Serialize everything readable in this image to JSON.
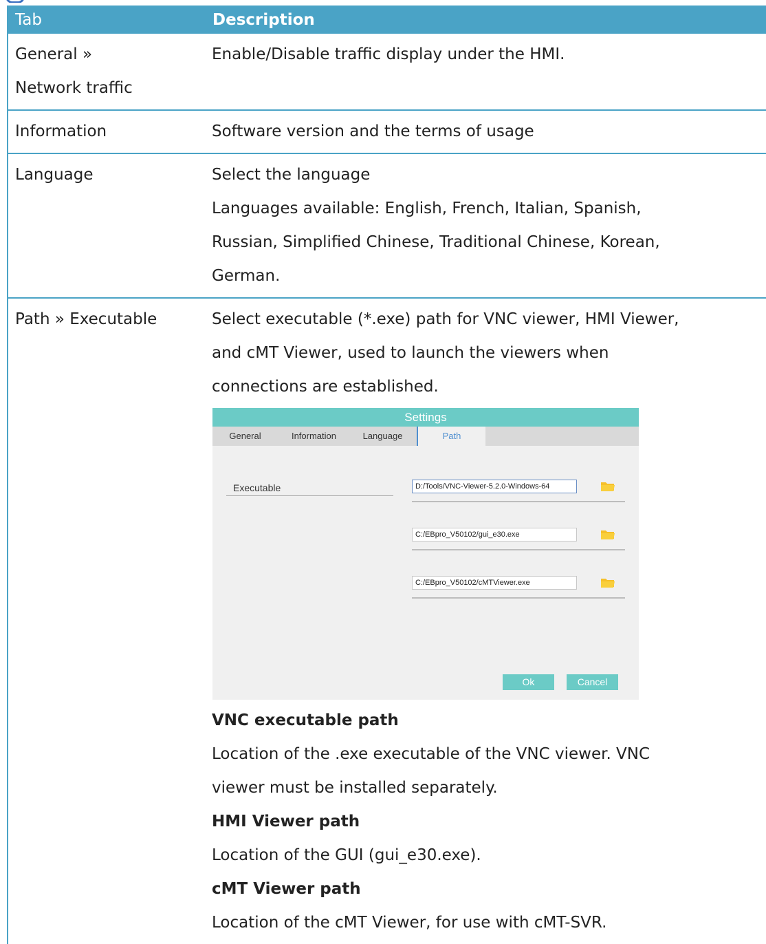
{
  "table": {
    "headers": {
      "tab": "Tab",
      "description": "Description"
    },
    "rows": {
      "general": {
        "tab_line1": "General »",
        "tab_line2": "Network traffic",
        "description": "Enable/Disable traffic display under the HMI."
      },
      "information": {
        "tab": "Information",
        "description": "Software version and the terms of usage"
      },
      "language": {
        "tab": "Language",
        "line1": "Select the language",
        "line2": "Languages available: English, French, Italian, Spanish,",
        "line3": "Russian, Simplified Chinese, Traditional Chinese, Korean,",
        "line4": "German."
      },
      "path": {
        "tab": "Path » Executable",
        "intro1": "Select executable (*.exe) path for VNC viewer, HMI Viewer,",
        "intro2": "and cMT Viewer, used to launch the viewers when",
        "intro3": "connections are established.",
        "vnc_heading": "VNC executable path",
        "vnc_text1": "Location of the .exe executable of the VNC viewer. VNC",
        "vnc_text2": "viewer must be installed separately.",
        "hmi_heading": "HMI Viewer path",
        "hmi_text": "Location of the GUI (gui_e30.exe).",
        "cmt_heading": "cMT Viewer path",
        "cmt_text": "Location of the cMT Viewer, for use with cMT-SVR."
      }
    }
  },
  "dialog": {
    "title": "Settings",
    "tabs": {
      "general": "General",
      "information": "Information",
      "language": "Language",
      "path": "Path"
    },
    "active_tab": "Path",
    "section_label": "Executable",
    "vnc": {
      "label": "VNC executable path",
      "value": "D:/Tools/VNC-Viewer-5.2.0-Windows-64"
    },
    "hmi": {
      "label": "HMI Viewer path",
      "value": "C:/EBpro_V50102/gui_e30.exe"
    },
    "cmt": {
      "label": "cMT Viewer path",
      "value": "C:/EBpro_V50102/cMTViewer.exe"
    },
    "buttons": {
      "ok": "Ok",
      "cancel": "Cancel"
    },
    "colors": {
      "accent": "#6bcbc6",
      "folder": "#f6c02a",
      "active_tab": "#4f8fd0"
    },
    "icons": {
      "browse": "folder-icon"
    }
  },
  "colors": {
    "table_header": "#4aa3c6",
    "table_border": "#4aa3c6"
  }
}
